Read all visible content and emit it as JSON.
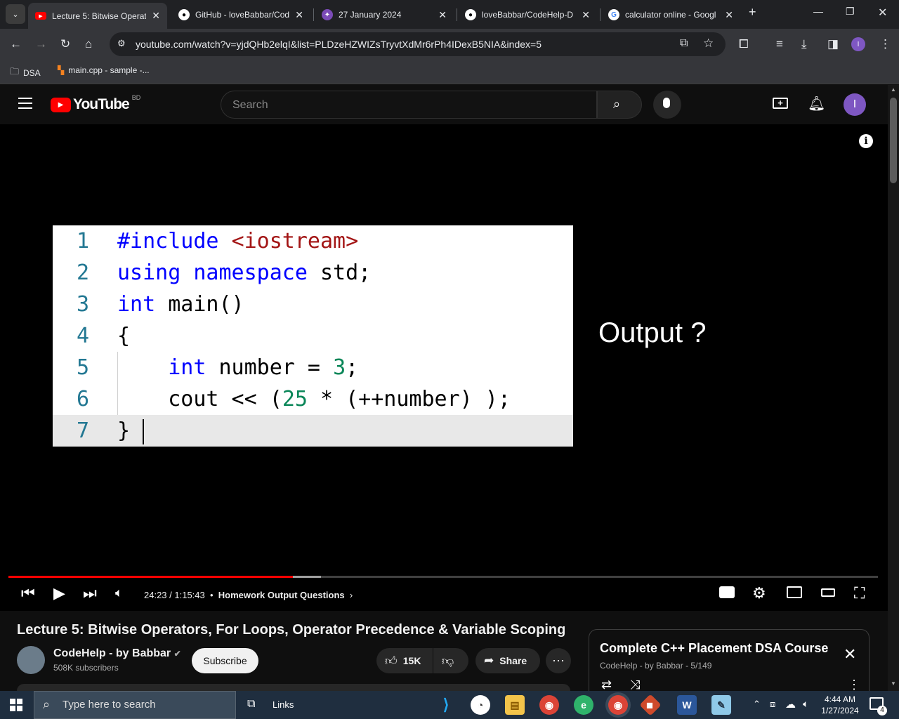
{
  "browser": {
    "tabs": [
      {
        "title": "Lecture 5: Bitwise Operat",
        "icon": "youtube-icon",
        "active": true
      },
      {
        "title": "GitHub - loveBabbar/Cod",
        "icon": "github-icon",
        "active": false
      },
      {
        "title": "27 January 2024",
        "icon": "alien-icon",
        "active": false
      },
      {
        "title": "loveBabbar/CodeHelp-D",
        "icon": "github-icon",
        "active": false
      },
      {
        "title": "calculator online - Googl",
        "icon": "google-icon",
        "active": false
      }
    ],
    "url": "youtube.com/watch?v=yjdQHb2elqI&list=PLDzeHZWIZsTryvtXdMr6rPh4IDexB5NIA&index=5",
    "bookmarks": [
      {
        "label": "DSA",
        "icon": "folder-icon"
      },
      {
        "label": "main.cpp - sample -...",
        "icon": "file-icon"
      }
    ],
    "profile_initial": "I"
  },
  "youtube": {
    "logo_text": "YouTube",
    "country_code": "BD",
    "search_placeholder": "Search",
    "avatar_initial": "I"
  },
  "video": {
    "code_lines": [
      {
        "num": "1",
        "text": "#include <iostream>"
      },
      {
        "num": "2",
        "text": "using namespace std;"
      },
      {
        "num": "3",
        "text": "int main()"
      },
      {
        "num": "4",
        "text": "{"
      },
      {
        "num": "5",
        "text": "    int number = 3;"
      },
      {
        "num": "6",
        "text": "    cout << (25 * (++number) );"
      },
      {
        "num": "7",
        "text": "}"
      }
    ],
    "output_label": "Output ?",
    "time": "24:23 / 1:15:43",
    "chapter": "Homework Output Questions",
    "progress_fraction": 0.327
  },
  "details": {
    "title": "Lecture 5: Bitwise Operators, For Loops, Operator Precedence & Variable Scoping",
    "channel": "CodeHelp - by Babbar",
    "subscribers": "508K subscribers",
    "subscribe_label": "Subscribe",
    "likes": "15K",
    "share_label": "Share"
  },
  "playlist": {
    "title": "Complete C++ Placement DSA Course",
    "subtitle": "CodeHelp - by Babbar - 5/149"
  },
  "taskbar": {
    "search_placeholder": "Type here to search",
    "links_label": "Links",
    "time": "4:44 AM",
    "date": "1/27/2024",
    "notification_count": "4"
  }
}
